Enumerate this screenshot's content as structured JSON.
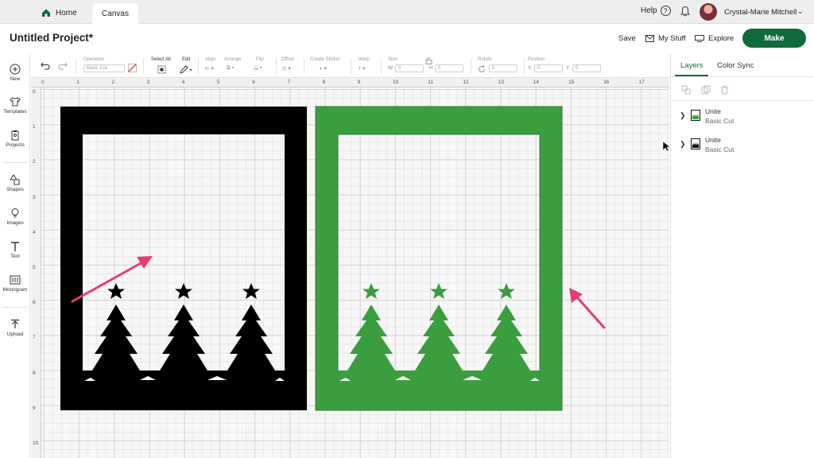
{
  "topbar": {
    "home_label": "Home",
    "canvas_tab": "Canvas",
    "help_label": "Help",
    "help_icon": "?",
    "user_name": "Crystal-Marie Mitchell",
    "user_chevron": "⌄"
  },
  "header": {
    "project_title": "Untitled Project*",
    "save_label": "Save",
    "mystuff_label": "My Stuff",
    "explore_label": "Explore",
    "make_label": "Make"
  },
  "sidebar": {
    "items": [
      {
        "label": "New"
      },
      {
        "label": "Templates"
      },
      {
        "label": "Projects"
      },
      {
        "label": "Shapes"
      },
      {
        "label": "Images"
      },
      {
        "label": "Text"
      },
      {
        "label": "Monogram"
      },
      {
        "label": "Upload"
      }
    ]
  },
  "toolbar": {
    "operation_label": "Operation",
    "operation_value": "Basic Cut",
    "select_all_label": "Select All",
    "edit_label": "Edit",
    "align_label": "Align",
    "arrange_label": "Arrange",
    "flip_label": "Flip",
    "offset_label": "Offset",
    "create_sticker_label": "Create Sticker",
    "warp_label": "Warp",
    "size_label": "Size",
    "size_w_label": "W",
    "size_w_value": "0",
    "size_h_label": "H",
    "size_h_value": "0",
    "rotate_label": "Rotate",
    "rotate_value": "0",
    "position_label": "Position",
    "pos_x_label": "X",
    "pos_x_value": "0",
    "pos_y_label": "Y",
    "pos_y_value": "0"
  },
  "rpanel": {
    "tab_layers": "Layers",
    "tab_colorsync": "Color Sync",
    "layers": [
      {
        "name": "Unite",
        "type": "Basic Cut",
        "thumb_color": "#3a9e3f"
      },
      {
        "name": "Unite",
        "type": "Basic Cut",
        "thumb_color": "#111111"
      }
    ]
  },
  "ruler": {
    "top": [
      "0",
      "1",
      "2",
      "3",
      "4",
      "5",
      "6",
      "7",
      "8",
      "9",
      "10",
      "11",
      "12",
      "13",
      "14",
      "15",
      "16",
      "17"
    ],
    "left": [
      "0",
      "1",
      "2",
      "3",
      "4",
      "5",
      "6",
      "7",
      "8",
      "9",
      "10"
    ]
  },
  "colors": {
    "brand_green": "#0f6b3a",
    "design_green": "#3a9e3f",
    "design_black": "#000000",
    "arrow_pink": "#e63b7a"
  }
}
